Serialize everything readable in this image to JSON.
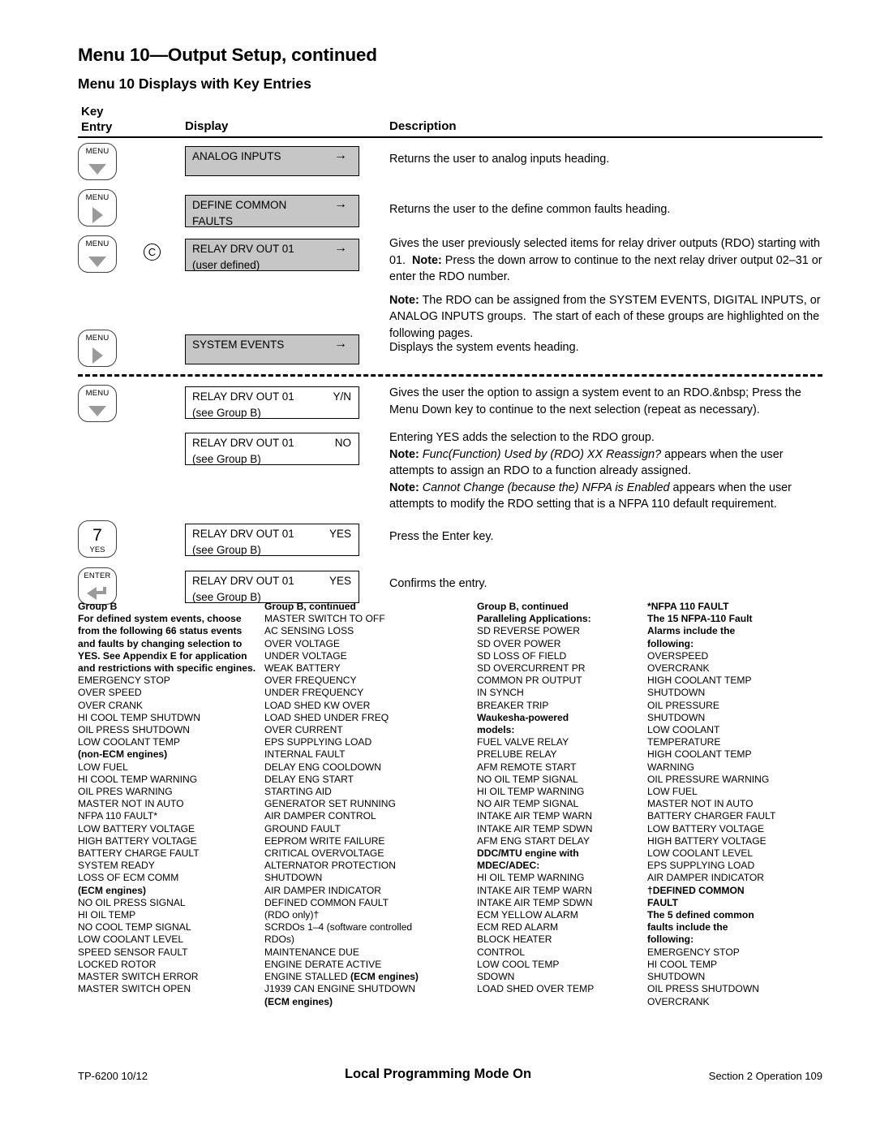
{
  "document": {
    "title": "Menu 10—Output Setup, continued",
    "subtitle": "Menu 10 Displays with Key Entries"
  },
  "table": {
    "headers": {
      "key_line1": "Key",
      "key_line2": "Entry",
      "display": "Display",
      "description": "Description"
    },
    "rows": [
      {
        "key": {
          "label": "MENU",
          "glyph": "triangle-down-icon"
        },
        "marker": null,
        "display": {
          "line1": "ANALOG INPUTS",
          "line2": "",
          "right": "→",
          "shade": "gray"
        },
        "description_html": "Returns the user to analog inputs heading."
      },
      {
        "key": {
          "label": "MENU",
          "glyph": "triangle-right-icon"
        },
        "marker": null,
        "display": {
          "line1": "DEFINE COMMON",
          "line2": "FAULTS",
          "right": "→",
          "shade": "gray"
        },
        "description_html": "Returns the user to the define common faults heading."
      },
      {
        "key": {
          "label": "MENU",
          "glyph": "triangle-down-icon"
        },
        "marker": "C",
        "display": {
          "line1": "RELAY DRV OUT 01",
          "line2": "(user defined)",
          "right": "→",
          "shade": "gray"
        },
        "description_html": "<p>Gives the user previously selected items for relay driver outputs (RDO) starting with 01.&nbsp; <b>Note:</b> Press the down arrow to continue to the next relay driver output 02–31 or enter the RDO number.</p><p style=\"margin-top:8px\"><b>Note:</b> The RDO can be assigned from the SYSTEM EVENTS, DIGITAL INPUTS, or ANALOG INPUTS groups.&nbsp; The start of each of these groups are highlighted on the following pages.</p>"
      },
      {
        "key": {
          "label": "MENU",
          "glyph": "triangle-right-icon"
        },
        "marker": null,
        "display": {
          "line1": "SYSTEM EVENTS",
          "line2": "",
          "right": "→",
          "shade": "gray"
        },
        "description_html": "Displays the system events heading."
      },
      {
        "key": {
          "label": "MENU",
          "glyph": "triangle-down-icon"
        },
        "marker": null,
        "display": {
          "line1": "RELAY DRV OUT 01",
          "line2": "(see Group B)",
          "right": "Y/N",
          "shade": "white"
        },
        "description_html": "Gives the user the option to assign a system event to an RDO.&nbsp; Press the Menu Down key to continue to the next selection (repeat as necessary)."
      },
      {
        "key": null,
        "marker": null,
        "display": {
          "line1": "RELAY DRV OUT 01",
          "line2": "(see Group B)",
          "right": "NO",
          "shade": "white"
        },
        "description_html": "<p>Entering YES adds the selection to the RDO group.</p><p><b>Note:</b> <i>Func(Function) Used by (RDO) XX Reassign?</i> appears when the user attempts to assign an RDO to a function already assigned.</p><p><b>Note:</b> <i>Cannot Change (because the) NFPA is Enabled</i> appears when the user attempts to modify the RDO setting that is a NFPA 110 default requirement.</p>"
      },
      {
        "key": {
          "label": "7",
          "sublabel": "YES",
          "glyph": "numeric-key"
        },
        "marker": null,
        "display": {
          "line1": "RELAY DRV OUT 01",
          "line2": "(see Group B)",
          "right": "YES",
          "shade": "white"
        },
        "description_html": "Press the Enter key."
      },
      {
        "key": {
          "label": "ENTER",
          "glyph": "enter-arrow-icon"
        },
        "marker": null,
        "display": {
          "line1": "RELAY DRV OUT 01",
          "line2": "(see Group B)",
          "right": "YES",
          "shade": "white"
        },
        "description_html": "Confirms the entry."
      }
    ]
  },
  "groups": {
    "column1": {
      "heading": "Group B",
      "intro": "For defined system events, choose from the following 66 status events and faults by changing selection to YES.  See Appendix E for application and restrictions with specific engines.",
      "items": [
        "EMERGENCY STOP",
        "OVER SPEED",
        "OVER CRANK",
        "HI COOL TEMP SHUTDWN",
        "OIL PRESS SHUTDOWN",
        "LOW COOLANT TEMP",
        "(non-ECM engines)",
        "LOW FUEL",
        "HI COOL TEMP WARNING",
        "OIL PRES WARNING",
        "MASTER NOT IN AUTO",
        "NFPA 110 FAULT*",
        "LOW BATTERY VOLTAGE",
        "HIGH BATTERY VOLTAGE",
        "BATTERY CHARGE FAULT",
        "SYSTEM READY",
        "LOSS OF ECM COMM",
        "(ECM engines)",
        "NO OIL PRESS SIGNAL",
        "HI OIL TEMP",
        "NO COOL TEMP SIGNAL",
        "LOW COOLANT LEVEL",
        "SPEED SENSOR FAULT",
        "LOCKED ROTOR",
        "MASTER SWITCH ERROR",
        "MASTER SWITCH OPEN"
      ],
      "bold_items": [
        "(non-ECM engines)",
        "(ECM engines)"
      ]
    },
    "column2": {
      "heading": "Group B, continued",
      "items": [
        "MASTER SWITCH TO OFF",
        "AC SENSING LOSS",
        "OVER VOLTAGE",
        "UNDER VOLTAGE",
        "WEAK BATTERY",
        "OVER FREQUENCY",
        "UNDER FREQUENCY",
        "LOAD SHED KW OVER",
        "LOAD SHED UNDER FREQ",
        "OVER CURRENT",
        "EPS SUPPLYING LOAD",
        "INTERNAL FAULT",
        "DELAY ENG COOLDOWN",
        "DELAY ENG START",
        "STARTING AID",
        "GENERATOR SET RUNNING",
        "AIR DAMPER CONTROL",
        "GROUND FAULT",
        "EEPROM WRITE FAILURE",
        "CRITICAL OVERVOLTAGE",
        "ALTERNATOR PROTECTION",
        "SHUTDOWN",
        "AIR DAMPER INDICATOR",
        "DEFINED COMMON FAULT",
        "(RDO only)†",
        "SCRDOs 1–4 (software controlled",
        "RDOs)",
        "MAINTENANCE DUE",
        "ENGINE DERATE ACTIVE",
        "ENGINE STALLED (ECM engines)",
        "J1939 CAN ENGINE SHUTDOWN",
        "(ECM engines)"
      ]
    },
    "column3": {
      "heading": "Group B, continued",
      "subheading1": "Paralleling Applications:",
      "items_a": [
        "SD REVERSE POWER",
        "SD OVER POWER",
        "SD LOSS OF FIELD",
        "SD OVERCURRENT PR",
        "COMMON PR OUTPUT",
        "IN SYNCH",
        "BREAKER TRIP"
      ],
      "subheading2_line1": "Waukesha-powered",
      "subheading2_line2": "models:",
      "items_b": [
        "FUEL VALVE RELAY",
        "PRELUBE RELAY",
        "AFM REMOTE START",
        "NO OIL TEMP SIGNAL",
        "HI OIL TEMP WARNING",
        "NO AIR TEMP SIGNAL",
        "INTAKE AIR TEMP WARN",
        "INTAKE AIR TEMP SDWN",
        "AFM ENG START DELAY"
      ],
      "subheading3_line1": "DDC/MTU engine with",
      "subheading3_line2": "MDEC/ADEC:",
      "items_c": [
        "HI OIL TEMP WARNING",
        "INTAKE AIR TEMP WARN",
        "INTAKE AIR TEMP SDWN",
        "ECM YELLOW ALARM",
        "ECM RED ALARM",
        "BLOCK HEATER",
        "CONTROL",
        "LOW COOL TEMP",
        "SDOWN",
        "LOAD SHED OVER TEMP"
      ]
    },
    "column4": {
      "heading": "*NFPA 110 FAULT",
      "intro_lines": [
        "The 15 NFPA-110 Fault",
        "Alarms include the",
        "following:"
      ],
      "items": [
        "OVERSPEED",
        "OVERCRANK",
        "HIGH COOLANT TEMP",
        "SHUTDOWN",
        "OIL PRESSURE",
        "SHUTDOWN",
        "LOW COOLANT",
        "TEMPERATURE",
        "HIGH COOLANT TEMP",
        "WARNING",
        "OIL PRESSURE WARNING",
        "LOW FUEL",
        "MASTER NOT IN AUTO",
        "BATTERY CHARGER FAULT",
        "LOW BATTERY VOLTAGE",
        "HIGH BATTERY VOLTAGE",
        "LOW COOLANT LEVEL",
        "EPS SUPPLYING LOAD",
        "AIR DAMPER INDICATOR"
      ],
      "heading2_line1": "†DEFINED COMMON",
      "heading2_line2": "FAULT",
      "intro2_lines": [
        "The 5 defined common",
        "faults include the",
        "following:"
      ],
      "items2": [
        "EMERGENCY STOP",
        "HI COOL TEMP",
        "SHUTDOWN",
        "OIL PRESS SHUTDOWN",
        "OVERCRANK"
      ]
    }
  },
  "footer": {
    "left": "TP-6200  10/12",
    "center": "Local Programming Mode On",
    "right": "Section 2  Operation   109"
  }
}
